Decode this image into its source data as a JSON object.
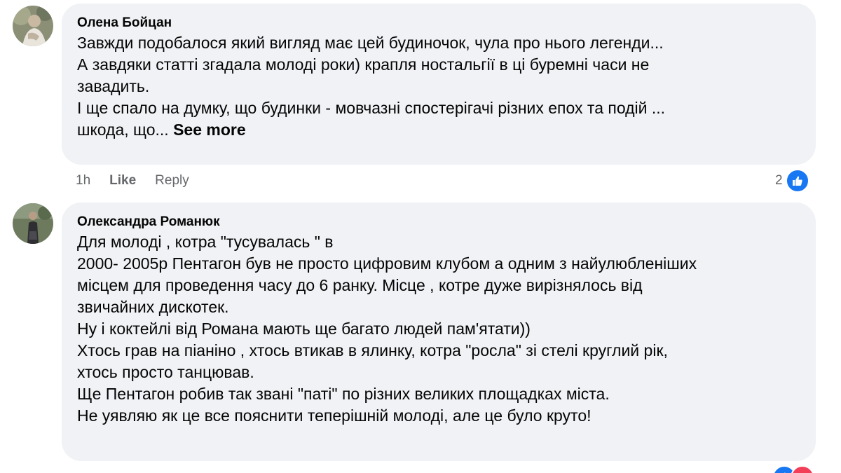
{
  "comments": [
    {
      "author": "Олена Бойцан",
      "lines": [
        "Завжди подобалося який вигляд має цей будиночок, чула про нього легенди...",
        "А завдяки статті згадала молоді роки) крапля ностальгії в ці буремні часи не",
        "завадить.",
        "І ще спало на думку, що будинки - мовчазні спостерігачі різних епох та подій ...",
        "шкода, що..."
      ],
      "see_more": "See more",
      "time": "1h",
      "like_label": "Like",
      "reply_label": "Reply",
      "reaction_count": "2",
      "reaction_icon": "like-icon",
      "accent_color": "#1877f2"
    },
    {
      "author": "Олександра Романюк",
      "lines": [
        "Для молоді , котра \"тусувалась \" в",
        "2000- 2005р Пентагон був не просто цифровим клубом а одним з найулюбленіших",
        "місцем для проведення часу до 6 ранку. Місце , котре дуже вирізнялось від",
        "звичайних дискотек.",
        "Ну і коктейлі від Романа мають ще багато людей пам'ятати))",
        "Хтось грав на піаніно , хтось втикав в ялинку, котра \"росла\" зі стелі круглий рік,",
        "хтось просто танцював.",
        "Ще Пентагон робив так звані \"паті\" по різних великих площадках міста.",
        "Не уявляю як це все пояснити теперішній молоді, але це було круто!"
      ],
      "reaction_icons": [
        "like-icon",
        "love-icon"
      ],
      "love_color": "#f33e58"
    }
  ]
}
